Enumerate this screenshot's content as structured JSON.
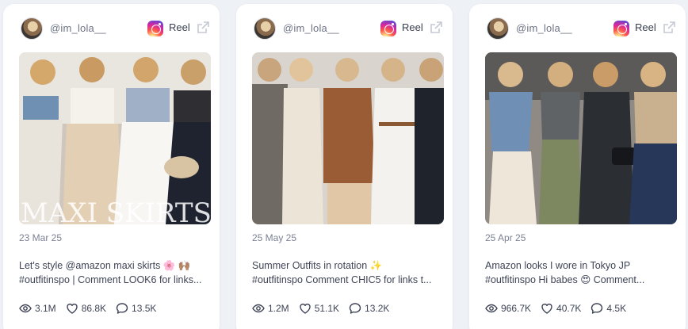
{
  "cards": [
    {
      "username": "@im_lola__",
      "post_type": "Reel",
      "image_overlay_text": "MAXI SKIRTS",
      "date": "23 Mar 25",
      "caption_line1": "Let's style @amazon maxi skirts 🌸 🙌🏽",
      "caption_line2": "#outfitinspo | Comment LOOK6 for links...",
      "views": "3.1M",
      "likes": "86.8K",
      "comments": "13.5K"
    },
    {
      "username": "@im_lola__",
      "post_type": "Reel",
      "image_overlay_text": "",
      "date": "25 May 25",
      "caption_line1": "Summer Outfits in rotation ✨",
      "caption_line2": "#outfitinspo Comment CHIC5 for links t...",
      "views": "1.2M",
      "likes": "51.1K",
      "comments": "13.2K"
    },
    {
      "username": "@im_lola__",
      "post_type": "Reel",
      "image_overlay_text": "",
      "date": "25 Apr 25",
      "caption_line1": "Amazon looks I wore in Tokyo JP",
      "caption_line2": "#outfitinspo Hi babes 😍 Comment...",
      "views": "966.7K",
      "likes": "40.7K",
      "comments": "4.5K"
    }
  ],
  "icons": {
    "platform": "instagram-icon",
    "external": "external-link-icon",
    "views": "eye-icon",
    "likes": "heart-icon",
    "comments": "comment-icon"
  },
  "colors": {
    "background": "#eef1f6",
    "card": "#ffffff",
    "muted_text": "#7b8294",
    "body_text": "#3e4456"
  }
}
